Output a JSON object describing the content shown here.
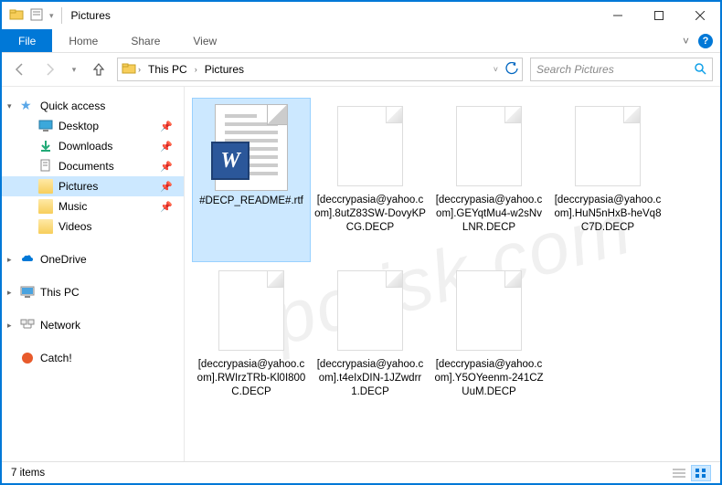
{
  "window": {
    "title": "Pictures"
  },
  "ribbon": {
    "file": "File",
    "tabs": [
      "Home",
      "Share",
      "View"
    ]
  },
  "breadcrumb": {
    "segments": [
      "This PC",
      "Pictures"
    ]
  },
  "search": {
    "placeholder": "Search Pictures"
  },
  "sidebar": {
    "quick_access": "Quick access",
    "items": [
      {
        "label": "Desktop",
        "pinned": true
      },
      {
        "label": "Downloads",
        "pinned": true
      },
      {
        "label": "Documents",
        "pinned": true
      },
      {
        "label": "Pictures",
        "pinned": true,
        "selected": true
      },
      {
        "label": "Music",
        "pinned": true
      },
      {
        "label": "Videos",
        "pinned": true
      }
    ],
    "onedrive": "OneDrive",
    "thispc": "This PC",
    "network": "Network",
    "catch": "Catch!"
  },
  "files": [
    {
      "name": "#DECP_README#.rtf",
      "type": "rtf",
      "selected": true
    },
    {
      "name": "[deccrypasia@yahoo.com].8utZ83SW-DovyKPCG.DECP",
      "type": "blank"
    },
    {
      "name": "[deccrypasia@yahoo.com].GEYqtMu4-w2sNvLNR.DECP",
      "type": "blank"
    },
    {
      "name": "[deccrypasia@yahoo.com].HuN5nHxB-heVq8C7D.DECP",
      "type": "blank"
    },
    {
      "name": "[deccrypasia@yahoo.com].RWIrzTRb-Kl0I800C.DECP",
      "type": "blank"
    },
    {
      "name": "[deccrypasia@yahoo.com].t4eIxDIN-1JZwdrr1.DECP",
      "type": "blank"
    },
    {
      "name": "[deccrypasia@yahoo.com].Y5OYeenm-241CZUuM.DECP",
      "type": "blank"
    }
  ],
  "status": {
    "count": "7 items"
  }
}
